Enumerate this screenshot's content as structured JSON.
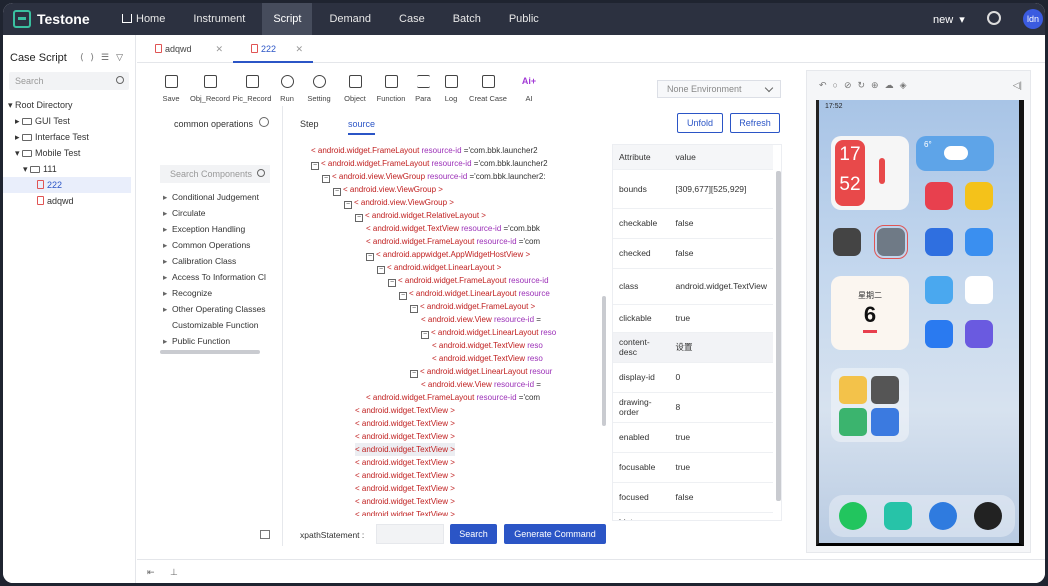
{
  "app": {
    "name": "Testone"
  },
  "nav": [
    "Home",
    "Instrument",
    "Script",
    "Demand",
    "Case",
    "Batch",
    "Public"
  ],
  "nav_active": "Script",
  "topright": {
    "project": "new",
    "avatar": "ldn"
  },
  "sidebar": {
    "title": "Case Script",
    "search_placeholder": "Search",
    "tree": [
      {
        "label": "Root Directory",
        "level": 0
      },
      {
        "label": "GUI Test",
        "level": 1
      },
      {
        "label": "Interface Test",
        "level": 1
      },
      {
        "label": "Mobile Test",
        "level": 1
      },
      {
        "label": "111",
        "level": 2
      },
      {
        "label": "222",
        "level": 3,
        "selected": true
      },
      {
        "label": "adqwd",
        "level": 3
      }
    ]
  },
  "tabs": [
    "adqwd",
    "222"
  ],
  "toolbar": [
    "Save",
    "Obj_Record",
    "Pic_Record",
    "Run",
    "Setting",
    "Object",
    "Function",
    "Para",
    "Log",
    "Creat Case",
    "AI"
  ],
  "environment": "None Environment",
  "components": {
    "title": "common operations",
    "search_placeholder": "Search Components",
    "items": [
      "Conditional Judgement",
      "Circulate",
      "Exception Handling",
      "Common Operations",
      "Calibration Class",
      "Access To Information Cl",
      "Recognize",
      "Other Operating Classes",
      "Customizable Function",
      "Public Function"
    ]
  },
  "subtabs": [
    "Step",
    "source"
  ],
  "buttons": {
    "unfold": "Unfold",
    "refresh": "Refresh",
    "search": "Search",
    "generate": "Generate Command"
  },
  "xml_lines": [
    {
      "tag": "android.widget.FrameLayout",
      "attr": "resource-id",
      "val": "='com.bbk.launcher2"
    },
    {
      "tag": "android.widget.FrameLayout",
      "attr": "resource-id",
      "val": "='com.bbk.launcher2"
    },
    {
      "tag": "android.view.ViewGroup",
      "attr": "resource-id",
      "val": "='com.bbk.launcher2:"
    },
    {
      "tag": "android.view.ViewGroup",
      "attr": "",
      "val": ""
    },
    {
      "tag": "android.view.ViewGroup",
      "attr": "",
      "val": ""
    },
    {
      "tag": "android.widget.RelativeLayout",
      "attr": "",
      "val": ""
    },
    {
      "tag": "android.widget.TextView",
      "attr": "resource-id",
      "val": "='com.bbk"
    },
    {
      "tag": "android.widget.FrameLayout",
      "attr": "resource-id",
      "val": "='com"
    },
    {
      "tag": "android.appwidget.AppWidgetHostView",
      "attr": "",
      "val": ""
    },
    {
      "tag": "android.widget.LinearLayout",
      "attr": "",
      "val": ""
    },
    {
      "tag": "android.widget.FrameLayout",
      "attr": "resource-id",
      "val": ""
    },
    {
      "tag": "android.widget.LinearLayout",
      "attr": "resource",
      "val": ""
    },
    {
      "tag": "android.widget.FrameLayout",
      "attr": "",
      "val": ""
    },
    {
      "tag": "android.view.View",
      "attr": "resource-id",
      "val": "="
    },
    {
      "tag": "android.widget.LinearLayout",
      "attr": "reso",
      "val": ""
    },
    {
      "tag": "android.widget.TextView",
      "attr": "reso",
      "val": ""
    },
    {
      "tag": "android.widget.TextView",
      "attr": "reso",
      "val": ""
    },
    {
      "tag": "android.widget.LinearLayout",
      "attr": "resour",
      "val": ""
    },
    {
      "tag": "android.view.View",
      "attr": "resource-id",
      "val": "="
    },
    {
      "tag": "android.widget.FrameLayout",
      "attr": "resource-id",
      "val": "='com"
    },
    {
      "tag": "android.widget.TextView",
      "attr": "",
      "val": ""
    },
    {
      "tag": "android.widget.TextView",
      "attr": "",
      "val": ""
    },
    {
      "tag": "android.widget.TextView",
      "attr": "",
      "val": ""
    },
    {
      "tag": "android.widget.TextView",
      "attr": "",
      "val": ""
    },
    {
      "tag": "android.widget.TextView",
      "attr": "",
      "val": ""
    },
    {
      "tag": "android.widget.TextView",
      "attr": "",
      "val": ""
    },
    {
      "tag": "android.widget.TextView",
      "attr": "",
      "val": ""
    },
    {
      "tag": "android.widget.TextView",
      "attr": "",
      "val": ""
    },
    {
      "tag": "android.widget.TextView",
      "attr": "",
      "val": ""
    }
  ],
  "attributes": {
    "header": [
      "Attribute",
      "value"
    ],
    "rows": [
      [
        "bounds",
        "[309,677][525,929]"
      ],
      [
        "checkable",
        "false"
      ],
      [
        "checked",
        "false"
      ],
      [
        "class",
        "android.widget.TextView"
      ],
      [
        "clickable",
        "true"
      ],
      [
        "content-desc",
        "设置"
      ],
      [
        "display-id",
        "0"
      ],
      [
        "drawing-order",
        "8"
      ],
      [
        "enabled",
        "true"
      ],
      [
        "focusable",
        "true"
      ],
      [
        "focused",
        "false"
      ],
      [
        "hint",
        ""
      ]
    ]
  },
  "xpath_label": "xpathStatement :",
  "phone": {
    "time": "17:52",
    "clock": [
      "17",
      "52"
    ],
    "weather": "6°",
    "calendar_day": "星期二",
    "calendar_date": "6"
  },
  "colors": {
    "accent": "#2b55c6",
    "topbar": "#2c3140",
    "xml_tag": "#c02020",
    "xml_attr": "#9b2fb7"
  }
}
